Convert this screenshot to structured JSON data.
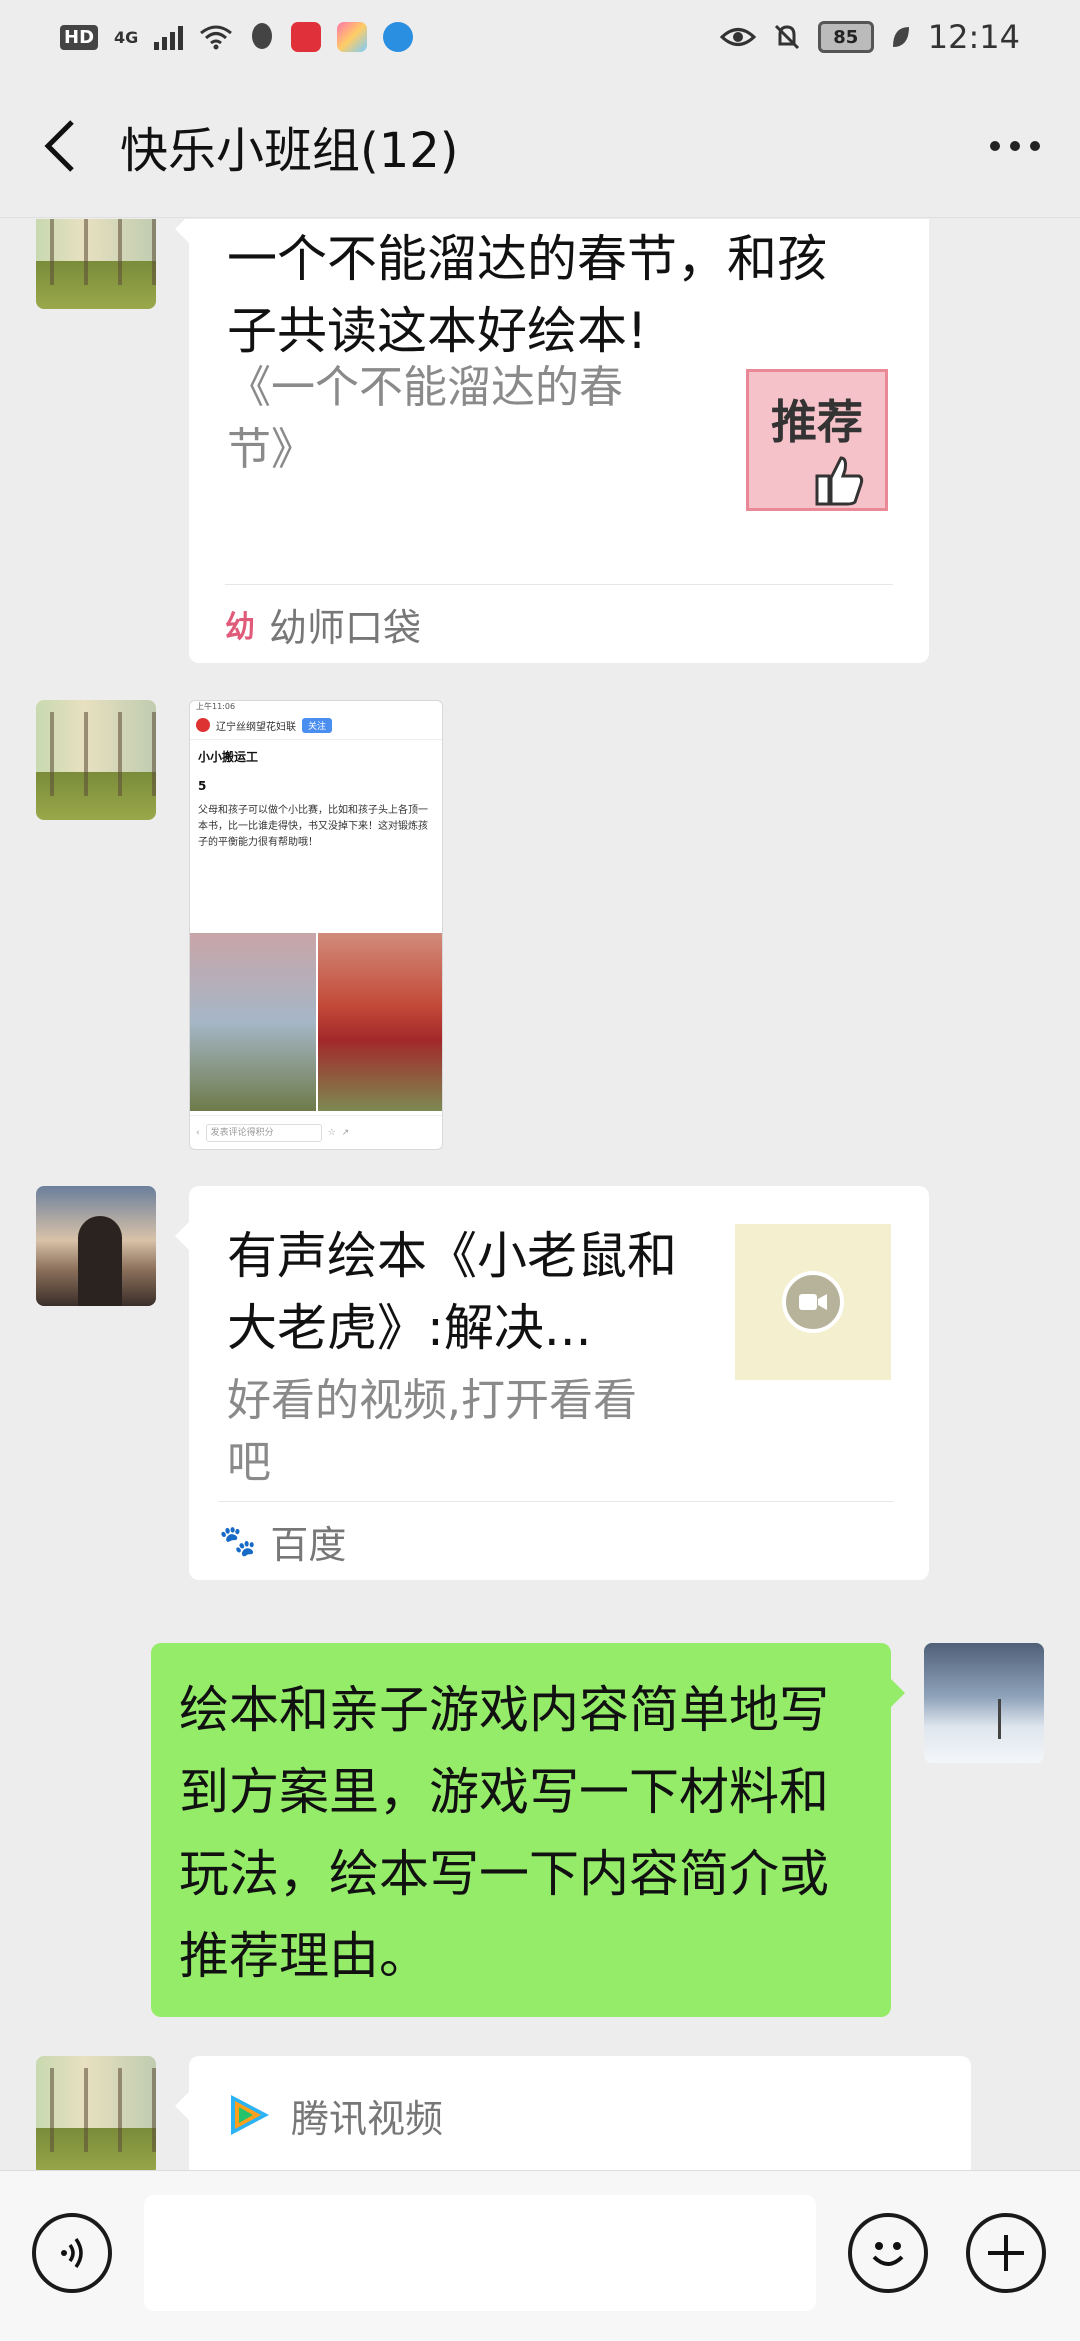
{
  "status_bar": {
    "hd": "HD",
    "network": "4G",
    "battery": "85",
    "time": "12:14"
  },
  "header": {
    "title": "快乐小班组(12)"
  },
  "messages": {
    "m1": {
      "title": "一个不能溜达的春节，和孩子共读这本好绘本!",
      "desc": "《一个不能溜达的春节》",
      "thumb_text": "推荐",
      "source": "幼师口袋"
    },
    "m2": {
      "status_time": "上午11:06",
      "account_name": "辽宁丝纲望花妇联",
      "follow": "关注",
      "heading": "小小搬运工",
      "number": "5",
      "text": "父母和孩子可以做个小比赛，比如和孩子头上各顶一本书，比一比谁走得快，书又没掉下来！这对锻炼孩子的平衡能力很有帮助哦！",
      "input_placeholder": "发表评论得积分"
    },
    "m3": {
      "title": "有声绘本《小老鼠和大老虎》:解决...",
      "desc": "好看的视频,打开看看吧",
      "source": "百度"
    },
    "m4": {
      "text": "绘本和亲子游戏内容简单地写到方案里，游戏写一下材料和玩法，绘本写一下内容简介或推荐理由。"
    },
    "m5": {
      "source": "腾讯视频"
    }
  },
  "colors": {
    "background": "#ededed",
    "bubble_self": "#95ec69",
    "bubble_other": "#ffffff",
    "source_text": "#777777"
  },
  "icons": {
    "back": "chevron-left-icon",
    "more": "more-dots-icon",
    "voice": "voice-icon",
    "emoji": "emoji-icon",
    "plus": "plus-icon"
  }
}
